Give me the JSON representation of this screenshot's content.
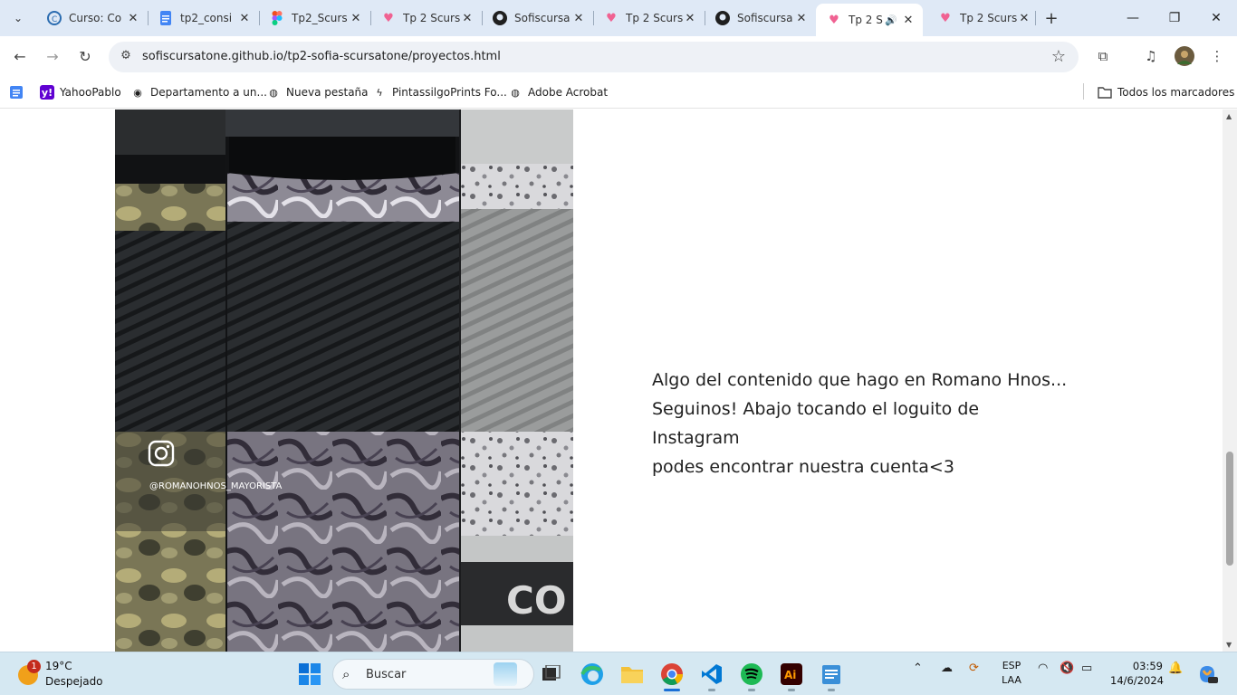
{
  "browser": {
    "tabs": [
      {
        "title": "Curso: Co",
        "icon": "edu-icon"
      },
      {
        "title": "tp2_consi",
        "icon": "docs-icon"
      },
      {
        "title": "Tp2_Scurs",
        "icon": "figma-icon"
      },
      {
        "title": "Tp 2 Scurs",
        "icon": "heart-icon"
      },
      {
        "title": "Sofiscursa",
        "icon": "github-icon"
      },
      {
        "title": "Tp 2 Scurs",
        "icon": "heart-icon"
      },
      {
        "title": "Sofiscursa",
        "icon": "github-icon"
      },
      {
        "title": "Tp 2 S",
        "icon": "heart-icon",
        "active": true,
        "audio": true
      },
      {
        "title": "Tp 2 Scurs",
        "icon": "heart-icon"
      }
    ],
    "url": "sofiscursatone.github.io/tp2-sofia-scursatone/proyectos.html",
    "bookmarks": [
      {
        "label": "YahooPablo",
        "icon": "yahoo-icon"
      },
      {
        "label": "Departamento a un...",
        "icon": "eye-icon"
      },
      {
        "label": "Nueva pestaña",
        "icon": "globe-icon"
      },
      {
        "label": "PintassilgoPrints Fo...",
        "icon": "bolt-icon"
      },
      {
        "label": "Adobe Acrobat",
        "icon": "globe-icon"
      }
    ],
    "all_bookmarks": "Todos los marcadores"
  },
  "page": {
    "photo_caption": "@ROMANOHNOS_MAYORISTA",
    "photo_brand": "CO",
    "description_lines": [
      "Algo del contenido que hago en Romano Hnos...",
      "Seguinos! Abajo tocando el loguito de Instagram",
      "podes encontrar nuestra cuenta<3"
    ]
  },
  "taskbar": {
    "weather_temp": "19°C",
    "weather_cond": "Despejado",
    "weather_badge": "1",
    "search_placeholder": "Buscar",
    "lang_top": "ESP",
    "lang_bottom": "LAA",
    "time": "03:59",
    "date": "14/6/2024"
  },
  "colors": {
    "tabstrip": "#dfe9f6",
    "omnibox": "#eef1f6",
    "taskbar": "#d5e8f2",
    "vscode": "#0078d4",
    "spotify": "#1db954",
    "illustrator": "#330000"
  }
}
